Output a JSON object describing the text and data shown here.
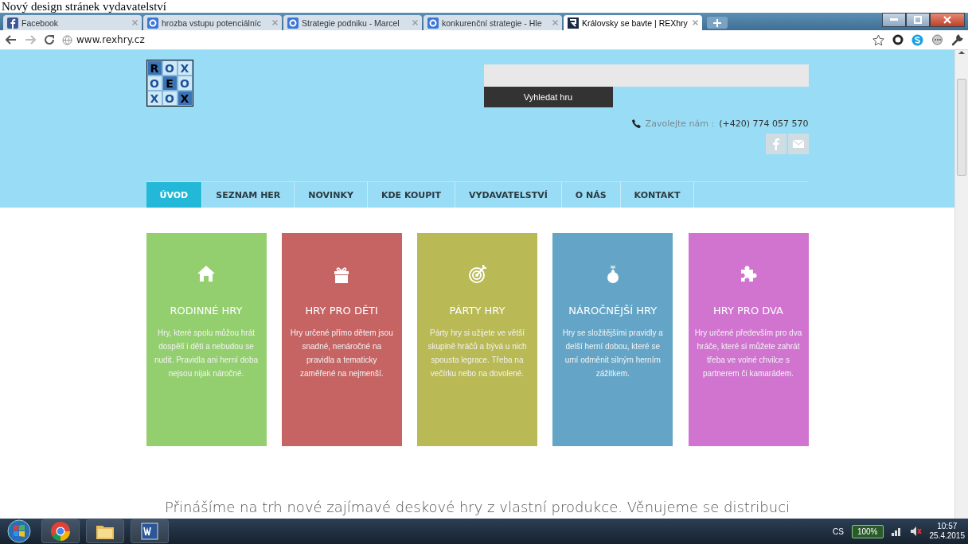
{
  "caption": "Nový design stránek vydavatelství",
  "browser": {
    "tabs": [
      {
        "title": "Facebook",
        "kind": "facebook",
        "selected": false
      },
      {
        "title": "hrozba vstupu potenciálníc",
        "kind": "google",
        "selected": false
      },
      {
        "title": "Strategie podniku - Marcel",
        "kind": "google",
        "selected": false
      },
      {
        "title": "konkurenční strategie - Hle",
        "kind": "google",
        "selected": false
      },
      {
        "title": "Královsky se bavte | REXhry",
        "kind": "rex",
        "selected": true
      }
    ],
    "address": "www.rexhry.cz"
  },
  "site": {
    "logo": [
      {
        "letter": "R",
        "dark": true
      },
      {
        "letter": "O",
        "dark": false
      },
      {
        "letter": "X",
        "dark": false
      },
      {
        "letter": "O",
        "dark": false
      },
      {
        "letter": "E",
        "dark": true
      },
      {
        "letter": "O",
        "dark": false
      },
      {
        "letter": "X",
        "dark": false
      },
      {
        "letter": "O",
        "dark": false
      },
      {
        "letter": "X",
        "dark": true
      }
    ],
    "search": {
      "button": "Vyhledat hru"
    },
    "phone_label": "Zavolejte nám :",
    "phone": "(+420) 774 057 570",
    "nav": [
      {
        "label": "ÚVOD",
        "selected": true
      },
      {
        "label": "SEZNAM HER",
        "selected": false
      },
      {
        "label": "NOVINKY",
        "selected": false
      },
      {
        "label": "KDE KOUPIT",
        "selected": false
      },
      {
        "label": "VYDAVATELSTVÍ",
        "selected": false
      },
      {
        "label": "O NÁS",
        "selected": false
      },
      {
        "label": "KONTAKT",
        "selected": false
      }
    ],
    "categories": [
      {
        "kind": "house",
        "color": "#94cf6f",
        "title": "RODINNÉ HRY",
        "text": "Hry, které spolu můžou hrát dospělí i děti a nebudou se nudit. Pravidla ani herní doba nejsou nijak náročné."
      },
      {
        "kind": "gift",
        "color": "#c66464",
        "title": "HRY PRO DĚTI",
        "text": "Hry určené přímo dětem jsou snadné, nenáročné na pravidla a tematicky zaměřené na nejmenší."
      },
      {
        "kind": "target",
        "color": "#b9b955",
        "title": "PÁRTY HRY",
        "text": "Párty hry si užijete ve větší skupině hráčů a bývá u nich spousta legrace. Třeba na večírku nebo na dovolené."
      },
      {
        "kind": "bomb",
        "color": "#64a5c7",
        "title": "NÁROČNĚJŠÍ HRY",
        "text": "Hry se složitějšími pravidly a delší herní dobou, které se umí odměnit silným herním zážitkem."
      },
      {
        "kind": "puzzle",
        "color": "#d074d0",
        "title": "HRY PRO DVA",
        "text": "Hry určené především pro dva hráče, které si můžete zahrát třeba ve volné chvilce s partnerem či kamarádem."
      }
    ],
    "intro": "Přinášíme na trh nové zajímavé deskové hry z vlastní produkce. Věnujeme se distribuci"
  },
  "taskbar": {
    "apps": [
      {
        "kind": "start"
      },
      {
        "kind": "chrome"
      },
      {
        "kind": "explorer"
      },
      {
        "kind": "word"
      }
    ],
    "language": "CS",
    "battery": "100%",
    "time": "10:57",
    "date": "25.4.2015"
  }
}
